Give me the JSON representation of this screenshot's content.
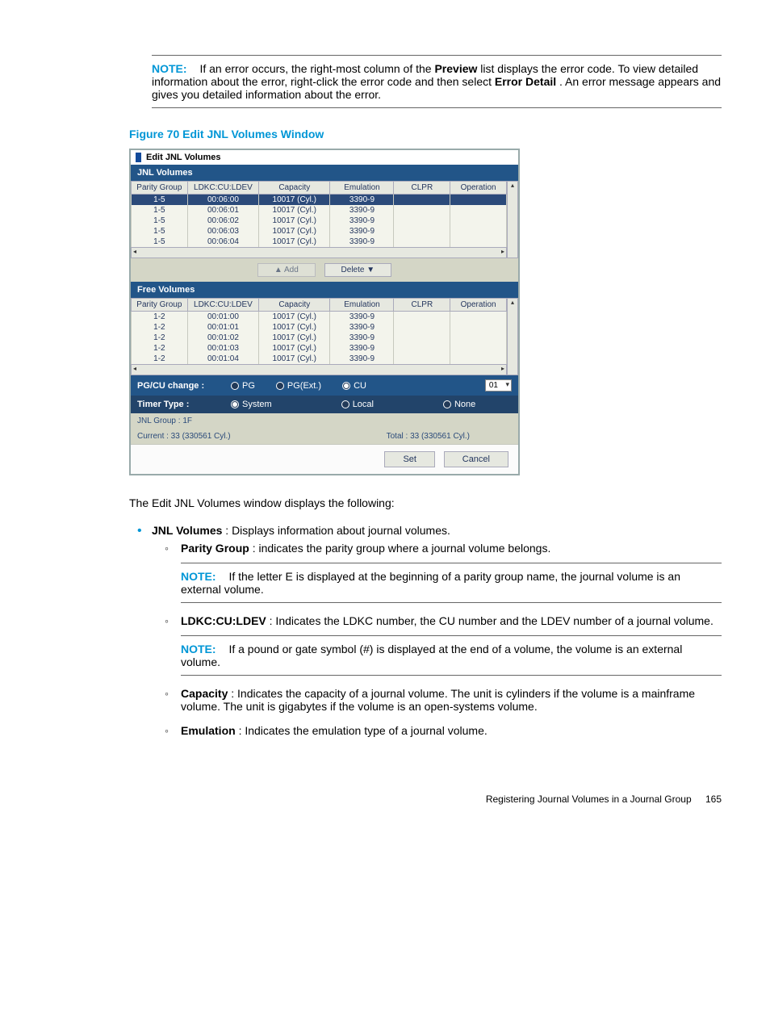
{
  "topNote": {
    "label": "NOTE:",
    "part1": "If an error occurs, the right-most column of the ",
    "bold1": "Preview",
    "part2": " list displays the error code. To view detailed information about the error, right-click the error code and then select ",
    "bold2": "Error Detail",
    "part3": ". An error message appears and gives you detailed information about the error."
  },
  "figureCaption": "Figure 70 Edit JNL Volumes Window",
  "dialog": {
    "title": "Edit JNL Volumes",
    "sections": {
      "jnl": "JNL Volumes",
      "free": "Free Volumes"
    },
    "headers": [
      "Parity Group",
      "LDKC:CU:LDEV",
      "Capacity",
      "Emulation",
      "CLPR",
      "Operation"
    ],
    "jnlRows": [
      {
        "pg": "1-5",
        "ldev": "00:06:00",
        "cap": "10017 (Cyl.)",
        "emu": "3390-9",
        "clpr": "",
        "op": ""
      },
      {
        "pg": "1-5",
        "ldev": "00:06:01",
        "cap": "10017 (Cyl.)",
        "emu": "3390-9",
        "clpr": "",
        "op": ""
      },
      {
        "pg": "1-5",
        "ldev": "00:06:02",
        "cap": "10017 (Cyl.)",
        "emu": "3390-9",
        "clpr": "",
        "op": ""
      },
      {
        "pg": "1-5",
        "ldev": "00:06:03",
        "cap": "10017 (Cyl.)",
        "emu": "3390-9",
        "clpr": "",
        "op": ""
      },
      {
        "pg": "1-5",
        "ldev": "00:06:04",
        "cap": "10017 (Cyl.)",
        "emu": "3390-9",
        "clpr": "",
        "op": ""
      }
    ],
    "freeRows": [
      {
        "pg": "1-2",
        "ldev": "00:01:00",
        "cap": "10017 (Cyl.)",
        "emu": "3390-9",
        "clpr": "",
        "op": ""
      },
      {
        "pg": "1-2",
        "ldev": "00:01:01",
        "cap": "10017 (Cyl.)",
        "emu": "3390-9",
        "clpr": "",
        "op": ""
      },
      {
        "pg": "1-2",
        "ldev": "00:01:02",
        "cap": "10017 (Cyl.)",
        "emu": "3390-9",
        "clpr": "",
        "op": ""
      },
      {
        "pg": "1-2",
        "ldev": "00:01:03",
        "cap": "10017 (Cyl.)",
        "emu": "3390-9",
        "clpr": "",
        "op": ""
      },
      {
        "pg": "1-2",
        "ldev": "00:01:04",
        "cap": "10017 (Cyl.)",
        "emu": "3390-9",
        "clpr": "",
        "op": ""
      }
    ],
    "addBtn": "▲ Add",
    "delBtn": "Delete ▼",
    "pgcu": {
      "label": "PG/CU change :",
      "opt1": "PG",
      "opt2": "PG(Ext.)",
      "opt3": "CU",
      "value": "01"
    },
    "timer": {
      "label": "Timer Type :",
      "opt1": "System",
      "opt2": "Local",
      "opt3": "None"
    },
    "jnlGroup": "JNL Group : 1F",
    "current": "Current : 33 (330561 Cyl.)",
    "total": "Total : 33 (330561 Cyl.)",
    "setBtn": "Set",
    "cancelBtn": "Cancel"
  },
  "intro": "The Edit JNL Volumes window displays the following:",
  "bullets": {
    "jnl": {
      "label": "JNL Volumes",
      "text": ": Displays information about journal volumes."
    },
    "parity": {
      "label": "Parity Group",
      "text": ": indicates the parity group where a journal volume belongs.",
      "noteLabel": "NOTE:",
      "noteText": "If the letter E is displayed at the beginning of a parity group name, the journal volume is an external volume."
    },
    "ldkc": {
      "label": "LDKC:CU:LDEV",
      "text": ": Indicates the LDKC number, the CU number and the LDEV number of a journal volume.",
      "noteLabel": "NOTE:",
      "noteText": "If a pound or gate symbol (#) is displayed at the end of a volume, the volume is an external volume."
    },
    "capacity": {
      "label": "Capacity",
      "text": ": Indicates the capacity of a journal volume. The unit is cylinders if the volume is a mainframe volume. The unit is gigabytes if the volume is an open-systems volume."
    },
    "emulation": {
      "label": "Emulation",
      "text": ": Indicates the emulation type of a journal volume."
    }
  },
  "footer": {
    "text": "Registering Journal Volumes in a Journal Group",
    "page": "165"
  }
}
